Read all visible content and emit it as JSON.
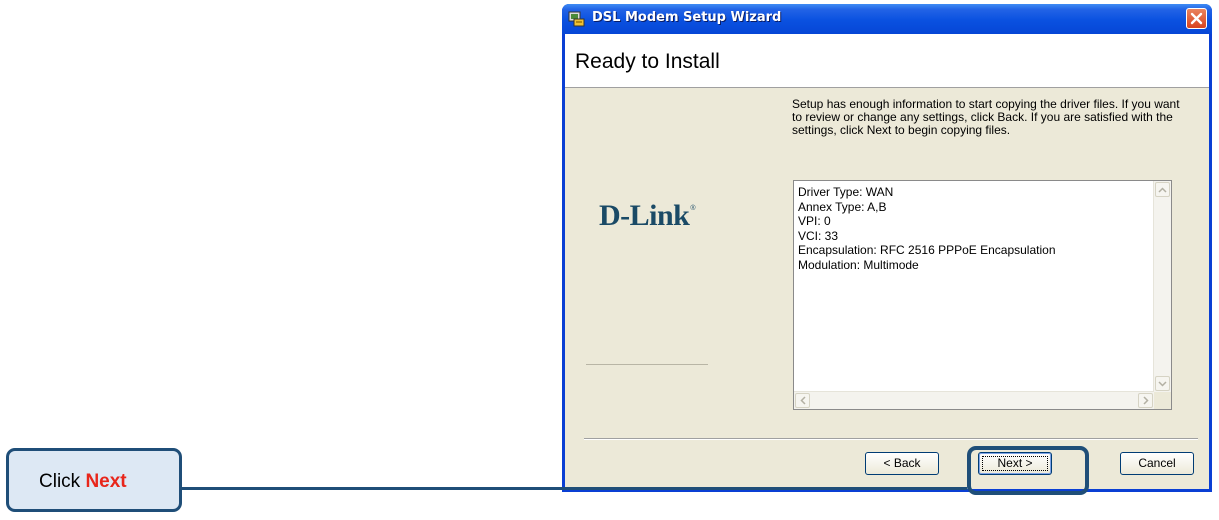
{
  "window": {
    "title": "DSL Modem Setup Wizard",
    "header": "Ready to Install",
    "logo": "D-Link",
    "logo_mark": "®",
    "description": "Setup has enough information to start copying the driver files. If you want to review or change any settings, click Back.  If you are satisfied with the settings, click Next to begin copying files.",
    "summary_lines": [
      "Driver Type: WAN",
      "Annex Type: A,B",
      "VPI: 0",
      "VCI: 33",
      "Encapsulation: RFC 2516 PPPoE Encapsulation",
      "Modulation: Multimode"
    ],
    "buttons": {
      "back": "< Back",
      "next": "Next >",
      "cancel": "Cancel"
    }
  },
  "callout": {
    "prefix": "Click ",
    "emphasis": "Next"
  },
  "colors": {
    "titlebar": "#0a51e0",
    "client_bg": "#ece9d8",
    "callout_border": "#1f4e78",
    "callout_fill": "#dde8f4",
    "callout_accent": "#e8261b",
    "logo": "#1a4a66"
  },
  "icons": {
    "app": "setup-app-icon",
    "close": "close-icon"
  }
}
